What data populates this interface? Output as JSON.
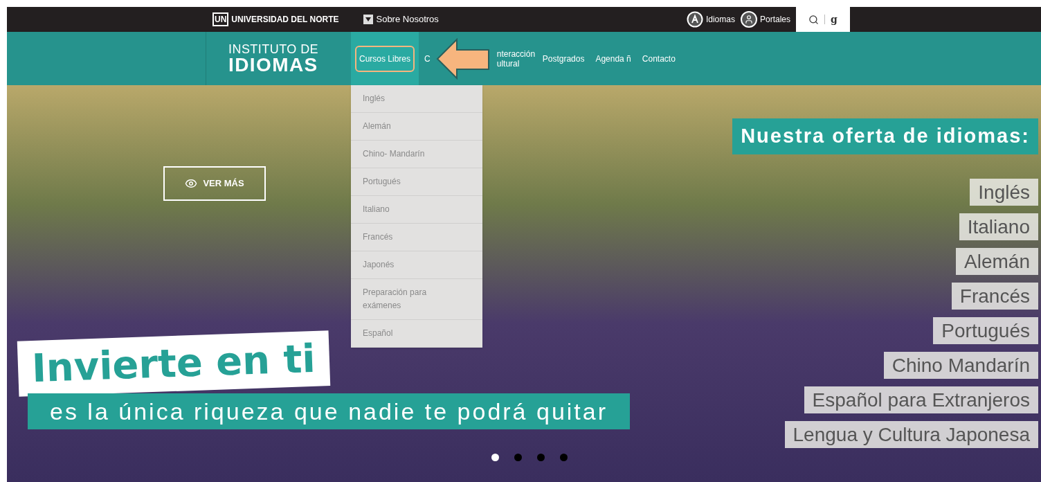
{
  "topbar": {
    "brand_mark": "UN",
    "brand": "UNIVERSIDAD DEL NORTE",
    "about": "Sobre Nosotros",
    "links": [
      {
        "kind": "idiomas",
        "label": "Idiomas"
      },
      {
        "kind": "portales",
        "label": "Portales"
      }
    ],
    "google": "g"
  },
  "nav": {
    "logo_line1": "INSTITUTO DE",
    "logo_line2": "IDIOMAS",
    "items": [
      {
        "label": "Cursos Libres",
        "selected": true
      },
      {
        "label": "C",
        "selected": false
      },
      {
        "label": "nteracción ultural",
        "selected": false
      },
      {
        "label": "Postgrados",
        "selected": false
      },
      {
        "label": "Agenda ñ",
        "selected": false
      },
      {
        "label": "Contacto",
        "selected": false
      }
    ]
  },
  "dropdown": [
    "Inglés",
    "Alemán",
    "Chino- Mandarín",
    "Portugués",
    "Italiano",
    "Francés",
    "Japonés",
    "Preparación para exámenes",
    "Español"
  ],
  "hero": {
    "button": "VER MÁS",
    "headline": "Invierte en ti",
    "tagline": "es la única riqueza que nadie te podrá quitar",
    "offer_title": "Nuestra oferta de idiomas:",
    "languages": [
      "Inglés",
      "Italiano",
      "Alemán",
      "Francés",
      "Portugués",
      "Chino Mandarín",
      "Español para Extranjeros",
      "Lengua y Cultura Japonesa"
    ],
    "dots": [
      {
        "selected": true
      },
      {
        "selected": false
      },
      {
        "selected": false
      },
      {
        "selected": false
      }
    ]
  }
}
